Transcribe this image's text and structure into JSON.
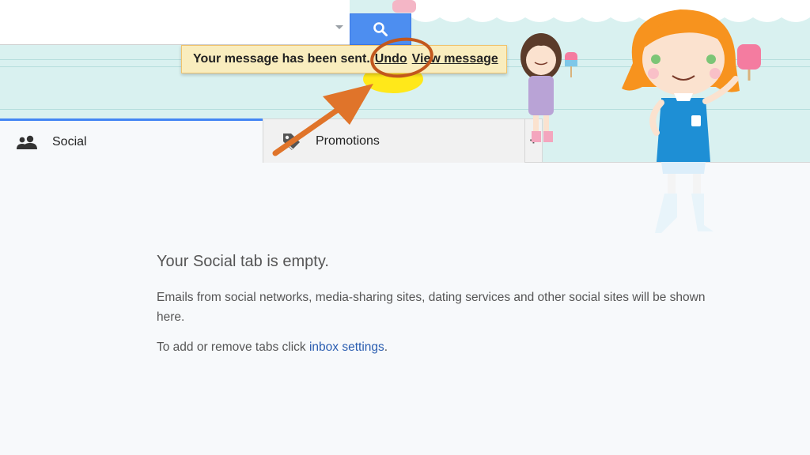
{
  "search": {
    "placeholder": "",
    "button_icon": "search-icon"
  },
  "notification": {
    "message": "Your message has been sent.",
    "undo_label": "Undo",
    "view_label": "View message"
  },
  "tabs": [
    {
      "label": "Social",
      "icon": "people-icon",
      "active": true
    },
    {
      "label": "Promotions",
      "icon": "tag-icon",
      "active": false
    }
  ],
  "add_tab_label": "+",
  "empty_state": {
    "title": "Your Social tab is empty.",
    "description": "Emails from social networks, media-sharing sites, dating services and other social sites will be shown here.",
    "tip_prefix": "To add or remove tabs click ",
    "tip_link": "inbox settings",
    "tip_suffix": "."
  },
  "colors": {
    "accent_blue": "#4285f4",
    "search_button": "#4d8ef0",
    "notice_bg": "#f9edbe",
    "link": "#2a5db0",
    "annotation_orange": "#e0742a"
  }
}
